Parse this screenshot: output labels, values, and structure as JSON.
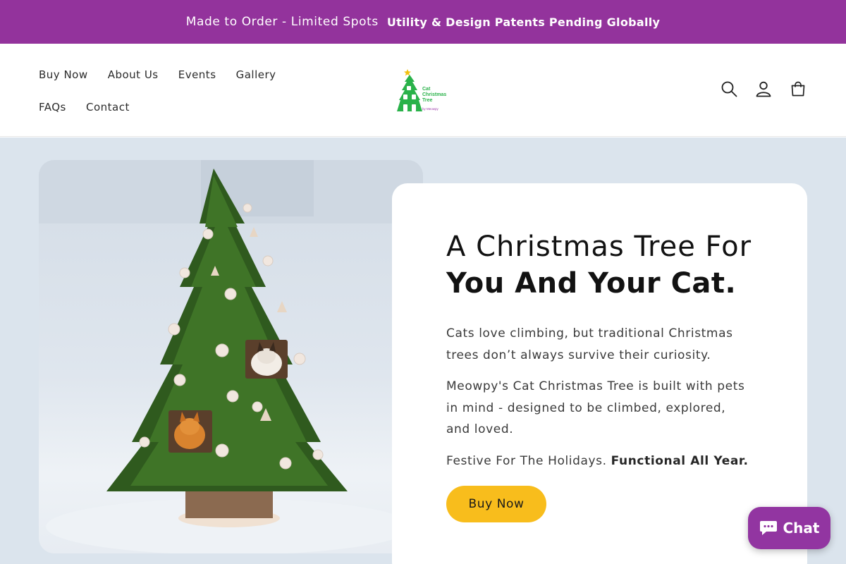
{
  "announcement": {
    "text": "Made to Order - Limited Spots",
    "highlight": "Utility & Design Patents Pending Globally",
    "background": "#93339c"
  },
  "header": {
    "nav": [
      "Buy Now",
      "About Us",
      "Events",
      "Gallery",
      "FAQs",
      "Contact"
    ],
    "logo": {
      "line1": "Cat",
      "line2": "Christmas",
      "line3": "Tree",
      "line4": "by Meowpy"
    },
    "icons": [
      "search-icon",
      "account-icon",
      "cart-icon"
    ]
  },
  "hero": {
    "heading_line1": "A Christmas Tree For",
    "heading_line2": "You And Your Cat.",
    "paragraph1": "Cats love climbing, but traditional Christmas trees don’t always survive their curiosity.",
    "paragraph2": "Meowpy's Cat Christmas Tree is built with pets in mind - designed to be climbed, explored, and loved.",
    "tagline_plain": "Festive For The Holidays.",
    "tagline_bold": "Functional All Year.",
    "button_label": "Buy Now",
    "background": "#dbe4ed",
    "button_color": "#f8bd1c"
  },
  "chat": {
    "label": "Chat",
    "color": "#9235a1"
  }
}
